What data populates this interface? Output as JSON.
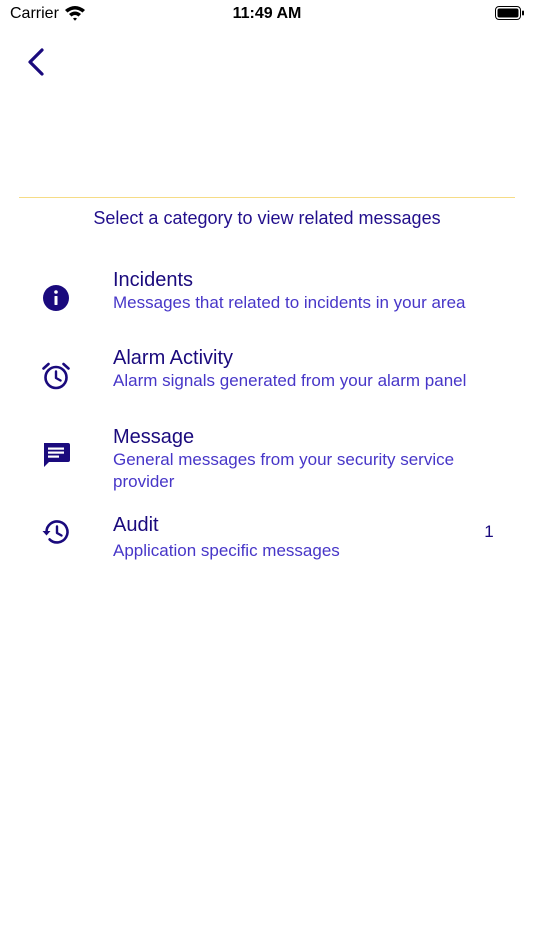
{
  "status_bar": {
    "carrier": "Carrier",
    "time": "11:49 AM",
    "icons": [
      "wifi-icon",
      "battery-icon"
    ]
  },
  "nav": {
    "back_icon": "chevron-left-icon"
  },
  "instruction": "Select a category to view related messages",
  "colors": {
    "primary": "#1a0a7d",
    "secondary_text": "#4736c8",
    "divider": "#f6dc86"
  },
  "categories": [
    {
      "icon": "info-icon",
      "title": "Incidents",
      "description": "Messages that related to incidents in your area",
      "count": ""
    },
    {
      "icon": "alarm-clock-icon",
      "title": "Alarm Activity",
      "description": "Alarm signals generated from your alarm panel",
      "count": ""
    },
    {
      "icon": "message-icon",
      "title": "Message",
      "description": "General messages from your security service provider",
      "count": ""
    },
    {
      "icon": "history-icon",
      "title": "Audit",
      "description": "Application specific messages",
      "count": "1"
    }
  ]
}
